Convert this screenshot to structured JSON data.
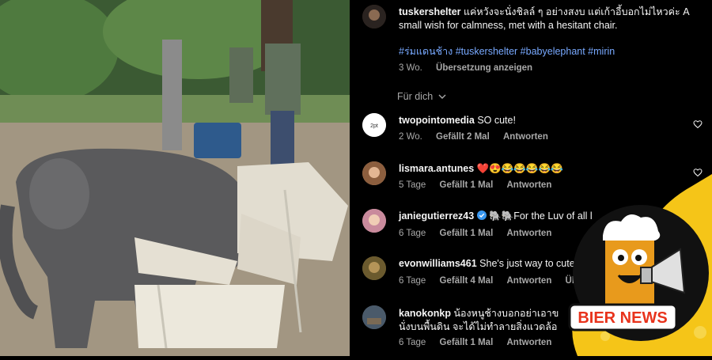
{
  "post": {
    "username": "tuskershelter",
    "caption": "แค่หวังจะนั่งชิลล์ ๆ อย่างสงบ แต่เก้าอี้บอกไม่ไหวค่ะ A small wish for calmness, met with a hesitant chair.",
    "hashtags": "#ร่มแดนช้าง #tuskershelter #babyelephant #mirin",
    "age": "3 Wo.",
    "translate_label": "Übersetzung anzeigen",
    "sort_label": "Für dich"
  },
  "comments": [
    {
      "username": "twopointomedia",
      "text": "SO cute!",
      "age": "2 Wo.",
      "likes": "Gefällt 2 Mal",
      "reply": "Antworten"
    },
    {
      "username": "lismara.antunes",
      "text": "❤️😍😂😂😂😂😂",
      "age": "5 Tage",
      "likes": "Gefällt 1 Mal",
      "reply": "Antworten"
    },
    {
      "username": "janiegutierrez43",
      "text": "🐘🐘For the Luv of all l",
      "age": "6 Tage",
      "likes": "Gefällt 1 Mal",
      "reply": "Antworten",
      "verified": true
    },
    {
      "username": "evonwilliams461",
      "text": "She's just way to cute",
      "age": "6 Tage",
      "likes": "Gefällt 4 Mal",
      "reply": "Antworten",
      "extra": "Überse"
    },
    {
      "username": "kanokonkp",
      "text": "น้องหนูช้างบอกอย่าเอาข",
      "text2": "นั่งบนพื้นดิน จะได้ไม่ทำลายสิ่งแวดล้อ",
      "age": "6 Tage",
      "likes": "Gefällt 1 Mal",
      "reply": "Antworten"
    }
  ],
  "badge": {
    "label": "BIER NEWS"
  },
  "colors": {
    "accent": "#f5c518",
    "hashtag": "#78a9ff",
    "badge_red": "#e8331c"
  },
  "icons": [
    "heart-icon",
    "chevron-down-icon",
    "verified-icon",
    "megaphone-icon"
  ]
}
